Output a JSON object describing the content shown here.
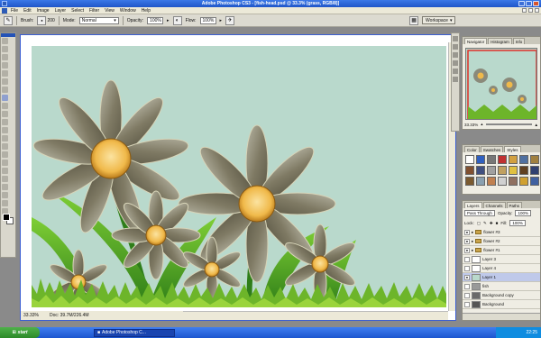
{
  "window": {
    "title": "Adobe Photoshop CS3 - [fish-head.psd @ 33.3% (grass, RGB/8)]"
  },
  "menu": [
    "File",
    "Edit",
    "Image",
    "Layer",
    "Select",
    "Filter",
    "View",
    "Window",
    "Help"
  ],
  "options": {
    "brush_label": "Brush:",
    "brush_size": "200",
    "mode_label": "Mode:",
    "mode_value": "Normal",
    "opacity_label": "Opacity:",
    "opacity_value": "100%",
    "flow_label": "Flow:",
    "flow_value": "100%",
    "workspace_label": "Workspace"
  },
  "document": {
    "zoom": "33.33%",
    "doc_size": "Doc: 39.7M/226.4M",
    "colors": {
      "canvas_bg": "#b9d9cc",
      "petal": "#8a8a7a",
      "center": "#f0b94a",
      "grass": "#6db52a"
    }
  },
  "navigator": {
    "tabs": [
      "Navigator",
      "Histogram",
      "Info"
    ],
    "zoom": "33.33%"
  },
  "styles": {
    "tabs": [
      "Color",
      "Swatches",
      "Styles"
    ]
  },
  "layers": {
    "tabs": [
      "Layers",
      "Channels",
      "Paths"
    ],
    "blend_mode": "Pass Through",
    "opacity_label": "Opacity:",
    "opacity_value": "100%",
    "lock_label": "Lock:",
    "fill_label": "Fill:",
    "fill_value": "100%",
    "items": [
      {
        "name": "flower #3",
        "type": "folder",
        "visible": true
      },
      {
        "name": "flower #2",
        "type": "folder",
        "visible": true
      },
      {
        "name": "flower #1",
        "type": "folder",
        "visible": true
      },
      {
        "name": "Layer 3",
        "type": "layer",
        "visible": false
      },
      {
        "name": "Layer 4",
        "type": "layer",
        "visible": false
      },
      {
        "name": "Layer 1",
        "type": "layer",
        "visible": true,
        "selected": true
      },
      {
        "name": "fish",
        "type": "layer",
        "visible": false
      },
      {
        "name": "Background copy",
        "type": "layer",
        "visible": false
      },
      {
        "name": "Background",
        "type": "layer",
        "visible": false
      }
    ]
  },
  "taskbar": {
    "start": "start",
    "task": "Adobe Photoshop C...",
    "clock": "22:25"
  }
}
